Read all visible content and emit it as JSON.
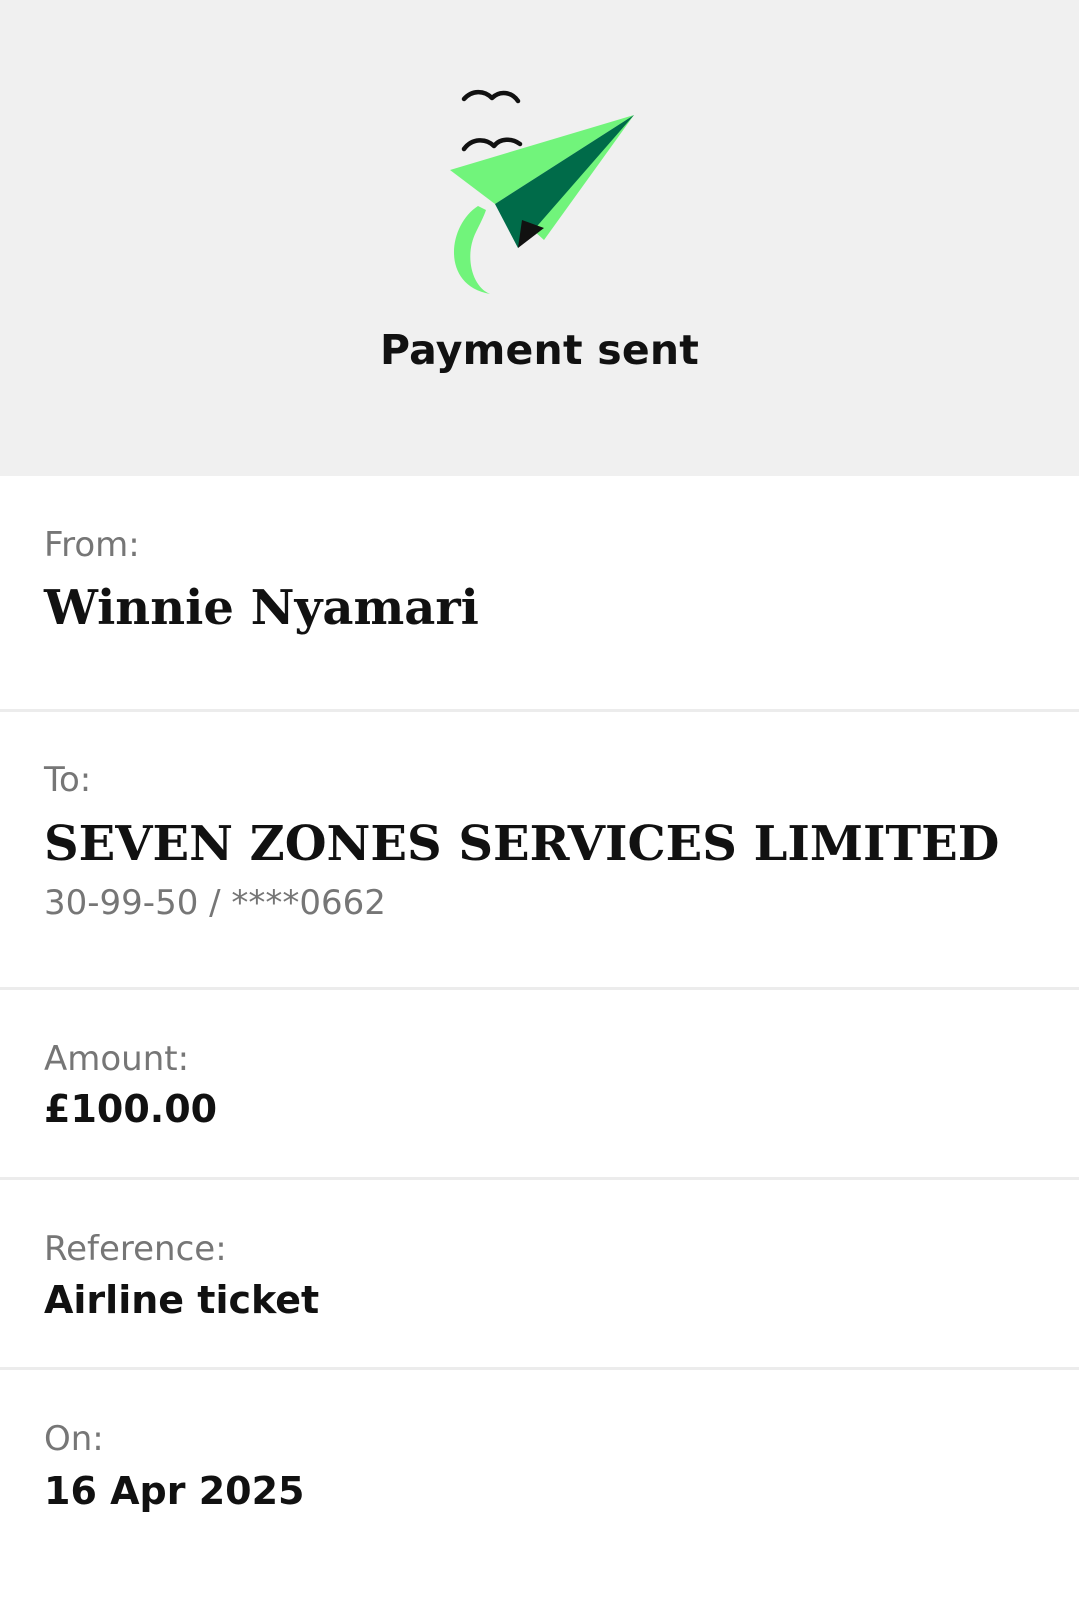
{
  "header": {
    "title": "Payment sent",
    "illustration_icon": "paper-plane-with-birds",
    "colors": {
      "light_green": "#71f47b",
      "dark_green": "#006b49",
      "ink": "#111111"
    }
  },
  "details": {
    "from": {
      "label": "From:",
      "value": "Winnie Nyamari"
    },
    "to": {
      "label": "To:",
      "value": "SEVEN ZONES SERVICES LIMITED",
      "account": "30-99-50 / ****0662"
    },
    "amount": {
      "label": "Amount:",
      "value": "£100.00"
    },
    "reference": {
      "label": "Reference:",
      "value": "Airline ticket"
    },
    "on": {
      "label": "On:",
      "value": "16 Apr 2025"
    }
  }
}
